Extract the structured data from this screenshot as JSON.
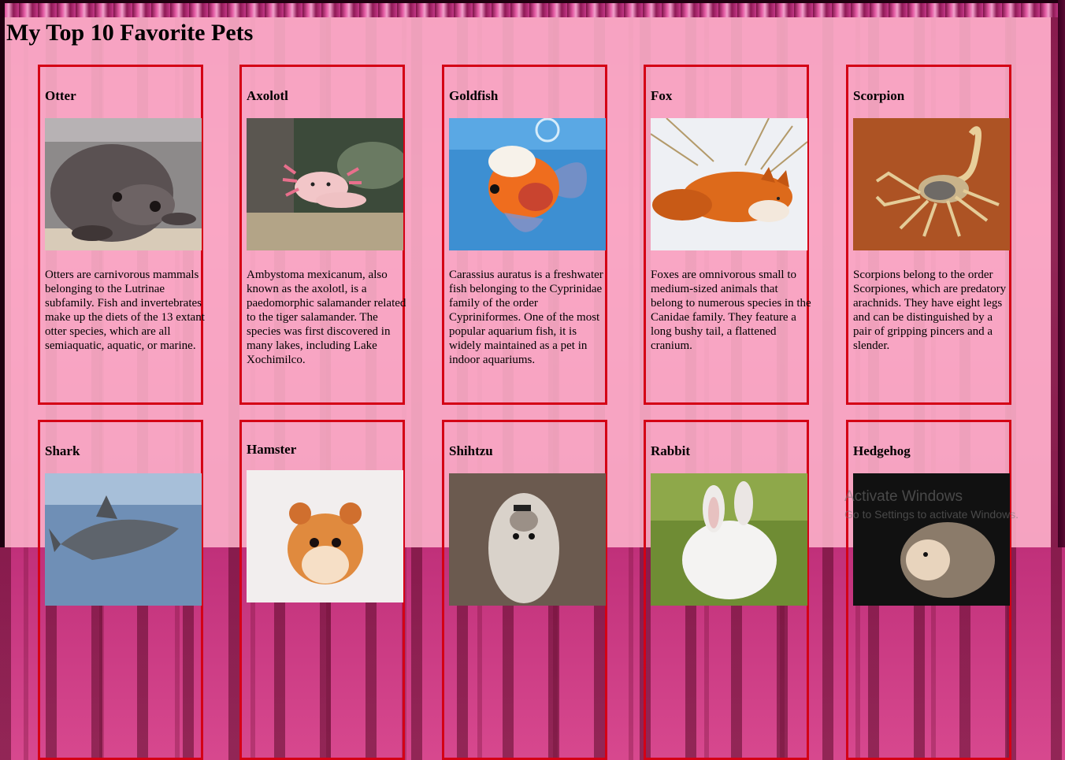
{
  "page": {
    "title": "My Top 10 Favorite Pets"
  },
  "pets": [
    {
      "name": "Otter",
      "icon": "otter-photo",
      "description": "Otters are carnivorous mammals belonging to the Lutrinae subfamily. Fish and invertebrates make up the diets of the 13 extant otter species, which are all semiaquatic, aquatic, or marine."
    },
    {
      "name": "Axolotl",
      "icon": "axolotl-photo",
      "description": "Ambystoma mexicanum, also known as the axolotl, is a paedomorphic salamander related to the tiger salamander. The species was first discovered in many lakes, including Lake Xochimilco."
    },
    {
      "name": "Goldfish",
      "icon": "goldfish-photo",
      "description": "Carassius auratus is a freshwater fish belonging to the Cyprinidae family of the order Cypriniformes. One of the most popular aquarium fish, it is widely maintained as a pet in indoor aquariums."
    },
    {
      "name": "Fox",
      "icon": "fox-photo",
      "description": "Foxes are omnivorous small to medium-sized animals that belong to numerous species in the Canidae family. They feature a long bushy tail, a flattened cranium."
    },
    {
      "name": "Scorpion",
      "icon": "scorpion-photo",
      "description": "Scorpions belong to the order Scorpiones, which are predatory arachnids. They have eight legs and can be distinguished by a pair of gripping pincers and a slender."
    },
    {
      "name": "Shark",
      "icon": "shark-photo",
      "description": ""
    },
    {
      "name": "Hamster",
      "icon": "hamster-photo",
      "description": ""
    },
    {
      "name": "Shihtzu",
      "icon": "shihtzu-photo",
      "description": ""
    },
    {
      "name": "Rabbit",
      "icon": "rabbit-photo",
      "description": ""
    },
    {
      "name": "Hedgehog",
      "icon": "hedgehog-photo",
      "description": ""
    }
  ],
  "watermark": {
    "line1": "Activate Windows",
    "line2": "Go to Settings to activate Windows."
  },
  "colors": {
    "card_border": "#d40015",
    "panel": "#ffb6cd",
    "background": "#c0307a"
  }
}
